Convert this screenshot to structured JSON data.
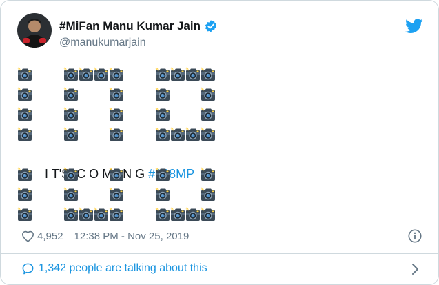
{
  "author": {
    "display_name": "#MiFan Manu Kumar Jain",
    "handle": "@manukumarjain",
    "verified": true
  },
  "tweet": {
    "middle_text": "I T'S  C O M I N G ",
    "hashtag": "#108MP",
    "emoji": "camera-with-flash-icon",
    "glyph_rows_top": [
      "X  XXXX  XXXX",
      "X  X  X  X  X",
      "X  X  X  X  X",
      "X  X  X  XXXX"
    ],
    "glyph_rows_bottom": [
      "X  X  X  X  X",
      "X  X  X  X  X",
      "X  XXXX  XXXX"
    ]
  },
  "stats": {
    "likes": "4,952",
    "timestamp": "12:38 PM - Nov 25, 2019"
  },
  "footer": {
    "talking": "1,342 people are talking about this"
  },
  "colors": {
    "accent": "#1b95e0",
    "muted": "#657786",
    "border": "#cfd9de",
    "verified": "#1da1f2"
  }
}
